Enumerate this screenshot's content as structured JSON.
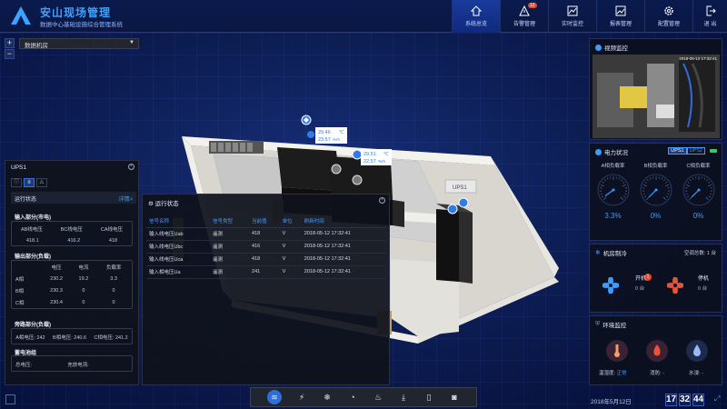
{
  "header": {
    "title": "安山现场管理",
    "subtitle": "数据中心基础设施综合管理系统",
    "nav": [
      {
        "label": "系统总览",
        "icon": "home-icon",
        "active": true
      },
      {
        "label": "告警管理",
        "icon": "alert-icon",
        "badge": "12"
      },
      {
        "label": "实时监控",
        "icon": "monitor-icon"
      },
      {
        "label": "报表管理",
        "icon": "report-icon"
      },
      {
        "label": "配置管理",
        "icon": "gear-icon"
      }
    ],
    "exit_label": "退 出"
  },
  "map": {
    "room_select": "数据机房",
    "sensor1": {
      "temp": "29.46",
      "temp_unit": "℃",
      "hum": "23.57",
      "hum_unit": "%rh"
    },
    "sensor2": {
      "temp": "29.51",
      "temp_unit": "℃",
      "hum": "22.57",
      "hum_unit": "%rh"
    },
    "ups_tag": "UPS1"
  },
  "ups_panel": {
    "title": "UPS1",
    "run_status": "运行状态",
    "detail_link": "详情>",
    "input_title": "输入部分(市电)",
    "input": [
      {
        "label": "AB线电压",
        "value": "418.1"
      },
      {
        "label": "BC线电压",
        "value": "416.2"
      },
      {
        "label": "CA线电压",
        "value": "418"
      }
    ],
    "output_title": "输出部分(负载)",
    "output_headers": [
      "",
      "电压",
      "电流",
      "负载率"
    ],
    "output_rows": [
      [
        "A相",
        "230.2",
        "19.2",
        "3.3"
      ],
      [
        "B相",
        "230.3",
        "0",
        "0"
      ],
      [
        "C相",
        "230.4",
        "0",
        "0"
      ]
    ],
    "bypass_title": "旁路部分(负载)",
    "bypass": [
      {
        "label": "A相电压: 242"
      },
      {
        "label": "B相电压: 240.6"
      },
      {
        "label": "C相电压: 241.2"
      }
    ],
    "battery_title": "蓄电池组",
    "battery": [
      {
        "label": "总电压:"
      },
      {
        "label": "充放电流:"
      }
    ]
  },
  "run_panel": {
    "title": "运行状态",
    "headers": [
      "信号名称",
      "信号类型",
      "当前值",
      "单位",
      "刷新时间"
    ],
    "rows": [
      [
        "输入线电压Uab",
        "遥测",
        "418",
        "V",
        "2018-05-12 17:32:41"
      ],
      [
        "输入线电压Ubc",
        "遥测",
        "416",
        "V",
        "2018-05-12 17:32:41"
      ],
      [
        "输入线电压Uca",
        "遥测",
        "418",
        "V",
        "2018-05-12 17:32:41"
      ],
      [
        "输入相电压Ua",
        "遥测",
        "241",
        "V",
        "2018-05-12 17:32:41"
      ]
    ]
  },
  "video": {
    "title": "视频监控",
    "timestamp": "2018-05-12 17:32:41"
  },
  "power": {
    "title": "电力状况",
    "ups_tabs": [
      "UPS1",
      "UPS2"
    ],
    "gauges": [
      {
        "label": "A相负载率",
        "value": "3.3%",
        "level": 0.033
      },
      {
        "label": "B相负载率",
        "value": "0%",
        "level": 0
      },
      {
        "label": "C相负载率",
        "value": "0%",
        "level": 0
      }
    ]
  },
  "ac": {
    "title": "机房制冷",
    "mode": "空调总数: 1 台",
    "on_label": "开机",
    "on_value": "0 台",
    "on_badge": "1",
    "off_label": "停机",
    "off_value": "0 台"
  },
  "env": {
    "title": "环境监控",
    "items": [
      {
        "label": "温湿度: ",
        "status": "正常"
      },
      {
        "label": "消防: ",
        "status": "-"
      },
      {
        "label": "水浸: ",
        "status": "-"
      }
    ]
  },
  "footer": {
    "date": "2018年5月12日",
    "clock": [
      "17",
      "32",
      "44"
    ]
  }
}
